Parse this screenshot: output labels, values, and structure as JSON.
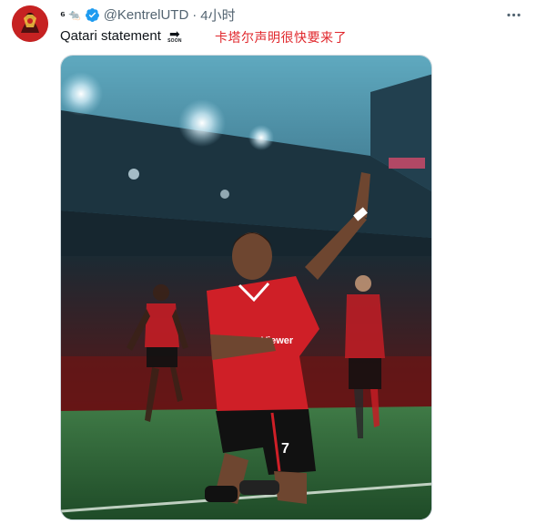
{
  "tweet": {
    "display_name": "⁶",
    "name_emoji": "🐀",
    "handle": "@KentrelUTD",
    "separator": "·",
    "time": "4小时",
    "text": "Qatari statement",
    "soon_emoji_label": "SOON",
    "more_icon": "more-horizontal-icon",
    "verified_icon": "verified-badge-icon",
    "verified_color": "#1d9bf0"
  },
  "annotation": {
    "text": "卡塔尔声明很快要来了",
    "color": "#e0262b"
  },
  "photo": {
    "kit_sponsor": "TeamViewer",
    "shirt_number": "7"
  }
}
